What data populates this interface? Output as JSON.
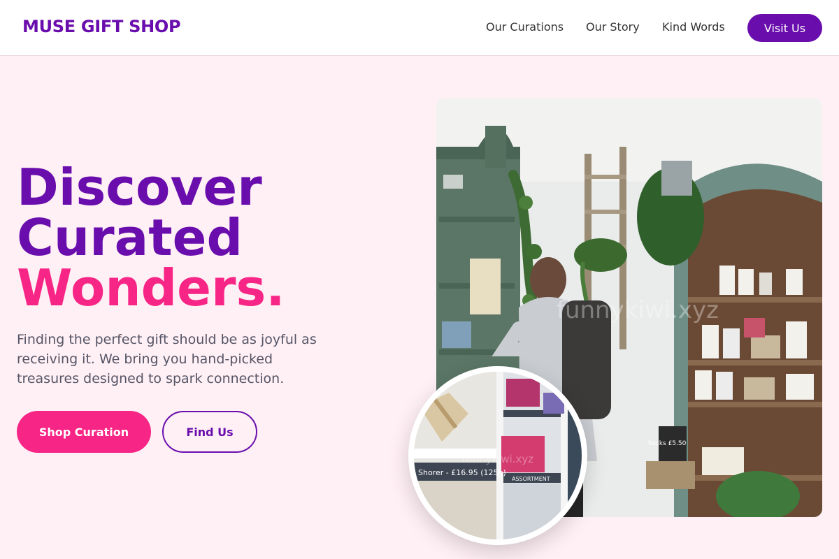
{
  "nav": {
    "brand": "MUSE GIFT SHOP",
    "links": [
      "Our Curations",
      "Our Story",
      "Kind Words"
    ],
    "cta": "Visit Us"
  },
  "hero": {
    "title_lines": [
      "Discover",
      "Curated",
      "Wonders."
    ],
    "description": "Finding the perfect gift should be as joyful as receiving it. We bring you hand-picked treasures designed to spark connection.",
    "primary_button": "Shop Curation",
    "secondary_button": "Find Us"
  },
  "images": {
    "main_watermark": "funnykiwi.xyz",
    "inset_watermark": "funnykiwi.xyz",
    "price_sign": "Shorer - £16.95 (125g)",
    "shelf_sign": "ASSORTMENT",
    "chalk_sign": "Socks £5.50"
  },
  "colors": {
    "primary": "#6a0dad",
    "accent": "#f72585",
    "background": "#fff0f5",
    "text": "#555566"
  }
}
